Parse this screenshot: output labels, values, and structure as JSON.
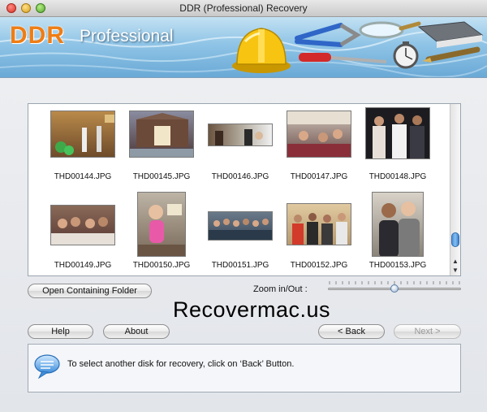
{
  "window": {
    "title": "DDR (Professional) Recovery"
  },
  "banner": {
    "brand": "DDR",
    "edition": "Professional"
  },
  "gallery": {
    "files": [
      {
        "name": "THD00144.JPG"
      },
      {
        "name": "THD00145.JPG"
      },
      {
        "name": "THD00146.JPG"
      },
      {
        "name": "THD00147.JPG"
      },
      {
        "name": "THD00148.JPG"
      },
      {
        "name": "THD00149.JPG"
      },
      {
        "name": "THD00150.JPG"
      },
      {
        "name": "THD00151.JPG"
      },
      {
        "name": "THD00152.JPG"
      },
      {
        "name": "THD00153.JPG"
      }
    ]
  },
  "toolbar": {
    "open_folder_label": "Open Containing Folder",
    "zoom_label": "Zoom in/Out :",
    "zoom_level": 0.5
  },
  "watermark": "Recovermac.us",
  "nav": {
    "help_label": "Help",
    "about_label": "About",
    "back_label": "< Back",
    "next_label": "Next >"
  },
  "status": {
    "message": "To select another disk for recovery, click on ‘Back’ Button."
  },
  "colors": {
    "brand_orange": "#ef7d14",
    "accent_blue": "#3b7fcf"
  }
}
